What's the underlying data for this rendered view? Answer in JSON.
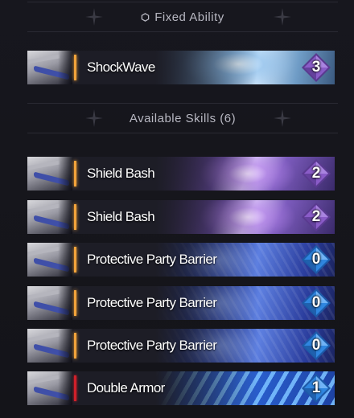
{
  "fixed_section": {
    "title": "Fixed Ability",
    "icon": "hexagon-icon"
  },
  "fixed_skill": {
    "name": "ShockWave",
    "cost": "3",
    "cost_color": "#8a5cc8",
    "accent": "gold",
    "art": "ice"
  },
  "available_section": {
    "title": "Available Skills (6)"
  },
  "skills": [
    {
      "name": "Shield Bash",
      "cost": "2",
      "cost_color": "#8a5cc8",
      "accent": "gold",
      "art": "purple"
    },
    {
      "name": "Shield Bash",
      "cost": "2",
      "cost_color": "#8a5cc8",
      "accent": "gold",
      "art": "purple"
    },
    {
      "name": "Protective Party Barrier",
      "cost": "0",
      "cost_color": "#2f86e0",
      "accent": "gold",
      "art": "blue"
    },
    {
      "name": "Protective Party Barrier",
      "cost": "0",
      "cost_color": "#2f86e0",
      "accent": "gold",
      "art": "blue"
    },
    {
      "name": "Protective Party Barrier",
      "cost": "0",
      "cost_color": "#2f86e0",
      "accent": "gold",
      "art": "blue"
    },
    {
      "name": "Double Armor",
      "cost": "1",
      "cost_color": "#2f86e0",
      "accent": "red",
      "art": "streaks"
    }
  ],
  "colors": {
    "background": "#16161d",
    "gold_accent": "#f2a33a",
    "red_accent": "#d0202a",
    "purple_cost": "#8a5cc8",
    "blue_cost": "#2f86e0"
  }
}
